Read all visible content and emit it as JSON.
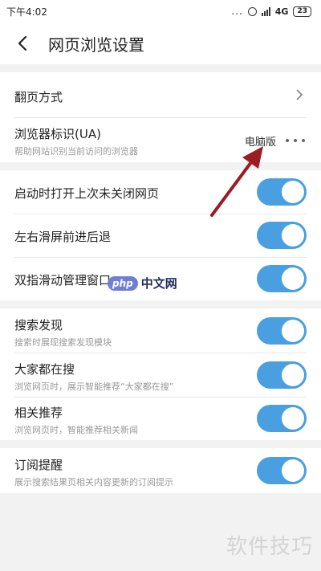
{
  "status_bar": {
    "time": "下午4:02",
    "signal_dots": "...",
    "network": "4G",
    "battery": "23",
    "icons": [
      "alarm-icon",
      "signal-icon",
      "battery-icon"
    ]
  },
  "header": {
    "title": "网页浏览设置",
    "back_icon": "back-chevron-icon"
  },
  "section1": {
    "page_flip": {
      "label": "翻页方式"
    },
    "ua": {
      "label": "浏览器标识(UA)",
      "subtitle": "帮助网站识别当前访问的浏览器",
      "value": "电脑版"
    }
  },
  "section2": {
    "items": [
      {
        "label": "启动时打开上次未关闭网页",
        "on": true
      },
      {
        "label": "左右滑屏前进后退",
        "on": true
      },
      {
        "label": "双指滑动管理窗口",
        "on": true
      }
    ]
  },
  "section3": {
    "items": [
      {
        "label": "搜索发现",
        "subtitle": "搜索时展现搜索发现模块",
        "on": true
      },
      {
        "label": "大家都在搜",
        "subtitle": "浏览网页时，展示智能推荐“大家都在搜”",
        "on": true
      },
      {
        "label": "相关推荐",
        "subtitle": "浏览网页时，智能推荐相关新闻",
        "on": true
      }
    ]
  },
  "section4": {
    "items": [
      {
        "label": "订阅提醒",
        "subtitle": "展示搜索结果页相关内容更新的订阅提示",
        "on": true
      }
    ]
  },
  "watermarks": {
    "php_logo": "php",
    "php_text": "中文网",
    "corner": "软件技巧"
  },
  "colors": {
    "toggle_on": "#4a9fe0",
    "annotation_arrow": "#9b1c22"
  }
}
